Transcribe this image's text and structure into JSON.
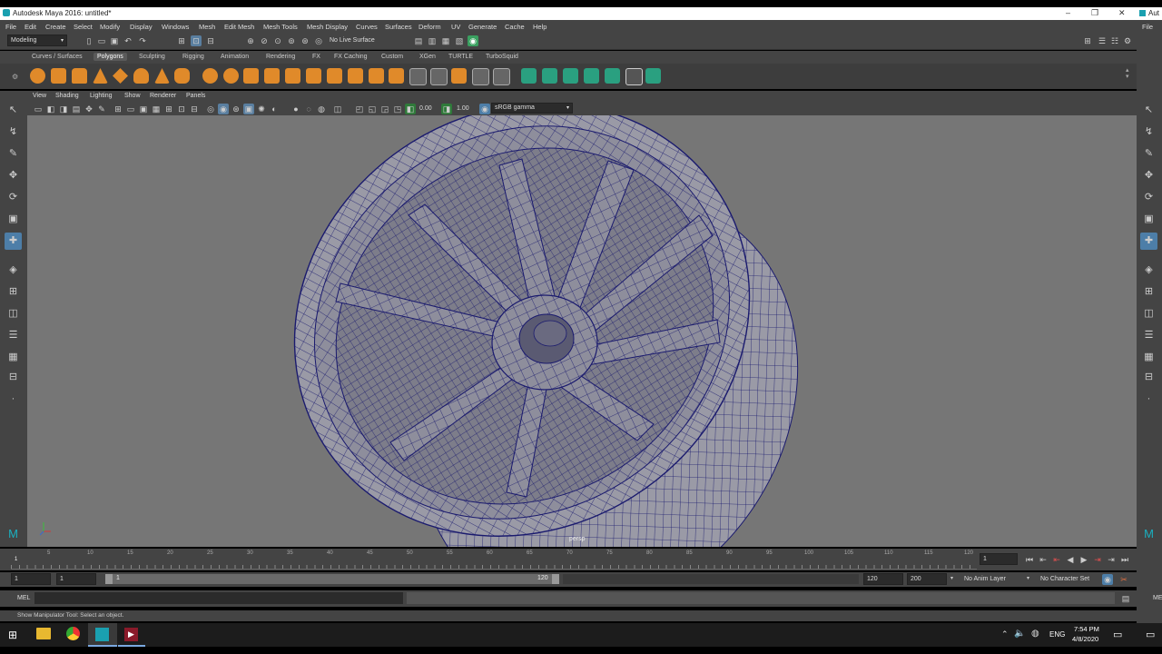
{
  "window": {
    "title": "Autodesk Maya 2016: untitled*",
    "right_title": "Aut",
    "minimize": "–",
    "restore": "❐",
    "close": "✕"
  },
  "menubar": {
    "items": [
      "File",
      "Edit",
      "Create",
      "Select",
      "Modify",
      "Display",
      "Windows",
      "Mesh",
      "Edit Mesh",
      "Mesh Tools",
      "Mesh Display",
      "Curves",
      "Surfaces",
      "Deform",
      "UV",
      "Generate",
      "Cache",
      "Help"
    ],
    "right_item": "File"
  },
  "status_line": {
    "mode": "Modeling",
    "live_surface": "No Live Surface"
  },
  "shelf_tabs": {
    "items": [
      "Curves / Surfaces",
      "Polygons",
      "Sculpting",
      "Rigging",
      "Animation",
      "Rendering",
      "FX",
      "FX Caching",
      "Custom",
      "XGen",
      "TURTLE",
      "TurboSquid"
    ],
    "active": "Polygons"
  },
  "panel_menu": {
    "items": [
      "View",
      "Shading",
      "Lighting",
      "Show",
      "Renderer",
      "Panels"
    ]
  },
  "panel_toolbar": {
    "exposure": "0.00",
    "gamma": "1.00",
    "color_space": "sRGB gamma"
  },
  "viewport": {
    "camera_label": "persp",
    "background": "#767676",
    "wire_color": "#1a1a6e"
  },
  "time_slider": {
    "ticks": [
      "1",
      "5",
      "10",
      "15",
      "20",
      "25",
      "30",
      "35",
      "40",
      "45",
      "50",
      "55",
      "60",
      "65",
      "70",
      "75",
      "80",
      "85",
      "90",
      "95",
      "100",
      "105",
      "110",
      "115",
      "120"
    ],
    "current_frame": "1"
  },
  "range_slider": {
    "start_time": "1",
    "playback_start": "1",
    "range_start": "1",
    "range_end": "120",
    "playback_end": "120",
    "end_time": "200",
    "anim_layer": "No Anim Layer",
    "character_set": "No Character Set"
  },
  "command_line": {
    "label": "MEL",
    "right_label": "ME"
  },
  "help_line": {
    "text": "Show Manipulator Tool: Select an object."
  },
  "taskbar": {
    "language": "ENG",
    "time": "7:54 PM",
    "date": "4/8/2020"
  }
}
